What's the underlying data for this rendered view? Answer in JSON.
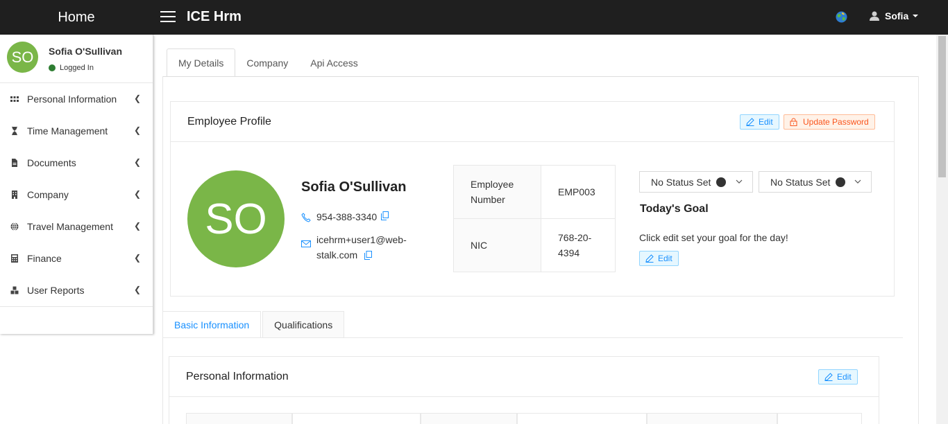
{
  "topbar": {
    "brand": "Home",
    "app_title": "ICE Hrm",
    "user_name": "Sofia",
    "icons": [
      "menu-icon",
      "globe-icon",
      "user-icon",
      "caret-down-icon"
    ]
  },
  "sidebar": {
    "user_initials": "SO",
    "user_name": "Sofia O'Sullivan",
    "user_status": "Logged In",
    "status_color": "#2e7d32",
    "items": [
      {
        "label": "Personal Information",
        "icon": "grid-icon"
      },
      {
        "label": "Time Management",
        "icon": "hourglass-icon"
      },
      {
        "label": "Documents",
        "icon": "document-icon"
      },
      {
        "label": "Company",
        "icon": "building-icon"
      },
      {
        "label": "Travel Management",
        "icon": "globe-icon"
      },
      {
        "label": "Finance",
        "icon": "calculator-icon"
      },
      {
        "label": "User Reports",
        "icon": "cubes-icon"
      }
    ]
  },
  "tabs_top": [
    "My Details",
    "Company",
    "Api Access"
  ],
  "profile": {
    "card_title": "Employee Profile",
    "edit_label": "Edit",
    "update_password_label": "Update Password",
    "initials": "SO",
    "name": "Sofia O'Sullivan",
    "phone": "954-388-3340",
    "email_line1": "icehrm+user1@web-",
    "email_line2": "stalk.com",
    "fields": [
      {
        "label_line1": "Employee",
        "label_line2": "Number",
        "value_line1": "EMP003",
        "value_line2": ""
      },
      {
        "label_line1": "NIC",
        "label_line2": "",
        "value_line1": "768-20-",
        "value_line2": "4394"
      }
    ],
    "status_selects": [
      "No Status Set",
      "No Status Set"
    ],
    "goal_title": "Today's Goal",
    "goal_text": "Click edit set your goal for the day!",
    "goal_edit_label": "Edit"
  },
  "tabs_lower": [
    "Basic Information",
    "Qualifications"
  ],
  "personal": {
    "card_title": "Personal Information",
    "edit_label": "Edit"
  },
  "colors": {
    "topbar": "#1f1f1f",
    "avatar": "#7ab648",
    "accent": "#1890ff",
    "danger": "#fa541c"
  }
}
